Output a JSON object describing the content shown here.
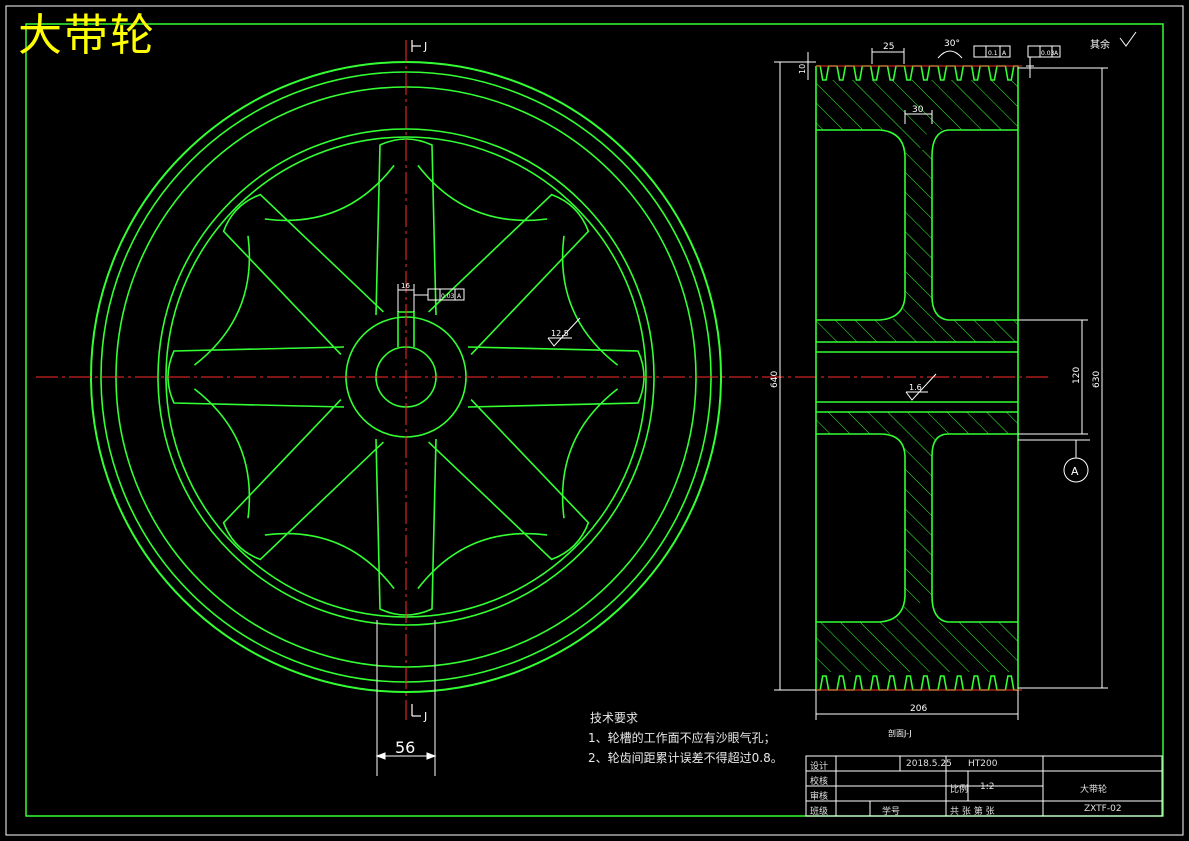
{
  "drawing_title": "大带轮",
  "surface_note": "其余",
  "section_marks": {
    "top": "J",
    "bottom": "J"
  },
  "dims": {
    "d56": "56",
    "d16": "16",
    "r125": "12.5",
    "d640": "640",
    "d630": "630",
    "d120": "120",
    "d206": "206",
    "d25": "25",
    "d30a": "30°",
    "d30b": "30",
    "d10": "10",
    "r16": "1.6"
  },
  "tolerances": {
    "key_sym": "0.03",
    "key_ref": "A",
    "flat": "0.1",
    "flat_ref": "A",
    "runout": "0.03",
    "runout_ref": "A"
  },
  "datum": "A",
  "section_label": "剖面J-J",
  "tech": {
    "heading": "技术要求",
    "line1": "1、轮槽的工作面不应有沙眼气孔；",
    "line2": "2、轮齿间距累计误差不得超过0.8。"
  },
  "title_block": {
    "design": "设计",
    "check": "校核",
    "review": "审核",
    "class": "班级",
    "student_no": "学号",
    "date": "2018.5.25",
    "material": "HT200",
    "scale_label": "比例",
    "scale": "1:2",
    "sheets": "共   张 第   张",
    "part_name": "大带轮",
    "drawing_no": "ZXTF-02"
  },
  "colors": {
    "outline": "#33ff33",
    "center": "#ff2a2a",
    "dim": "#ffffff",
    "title": "#ffff00"
  }
}
